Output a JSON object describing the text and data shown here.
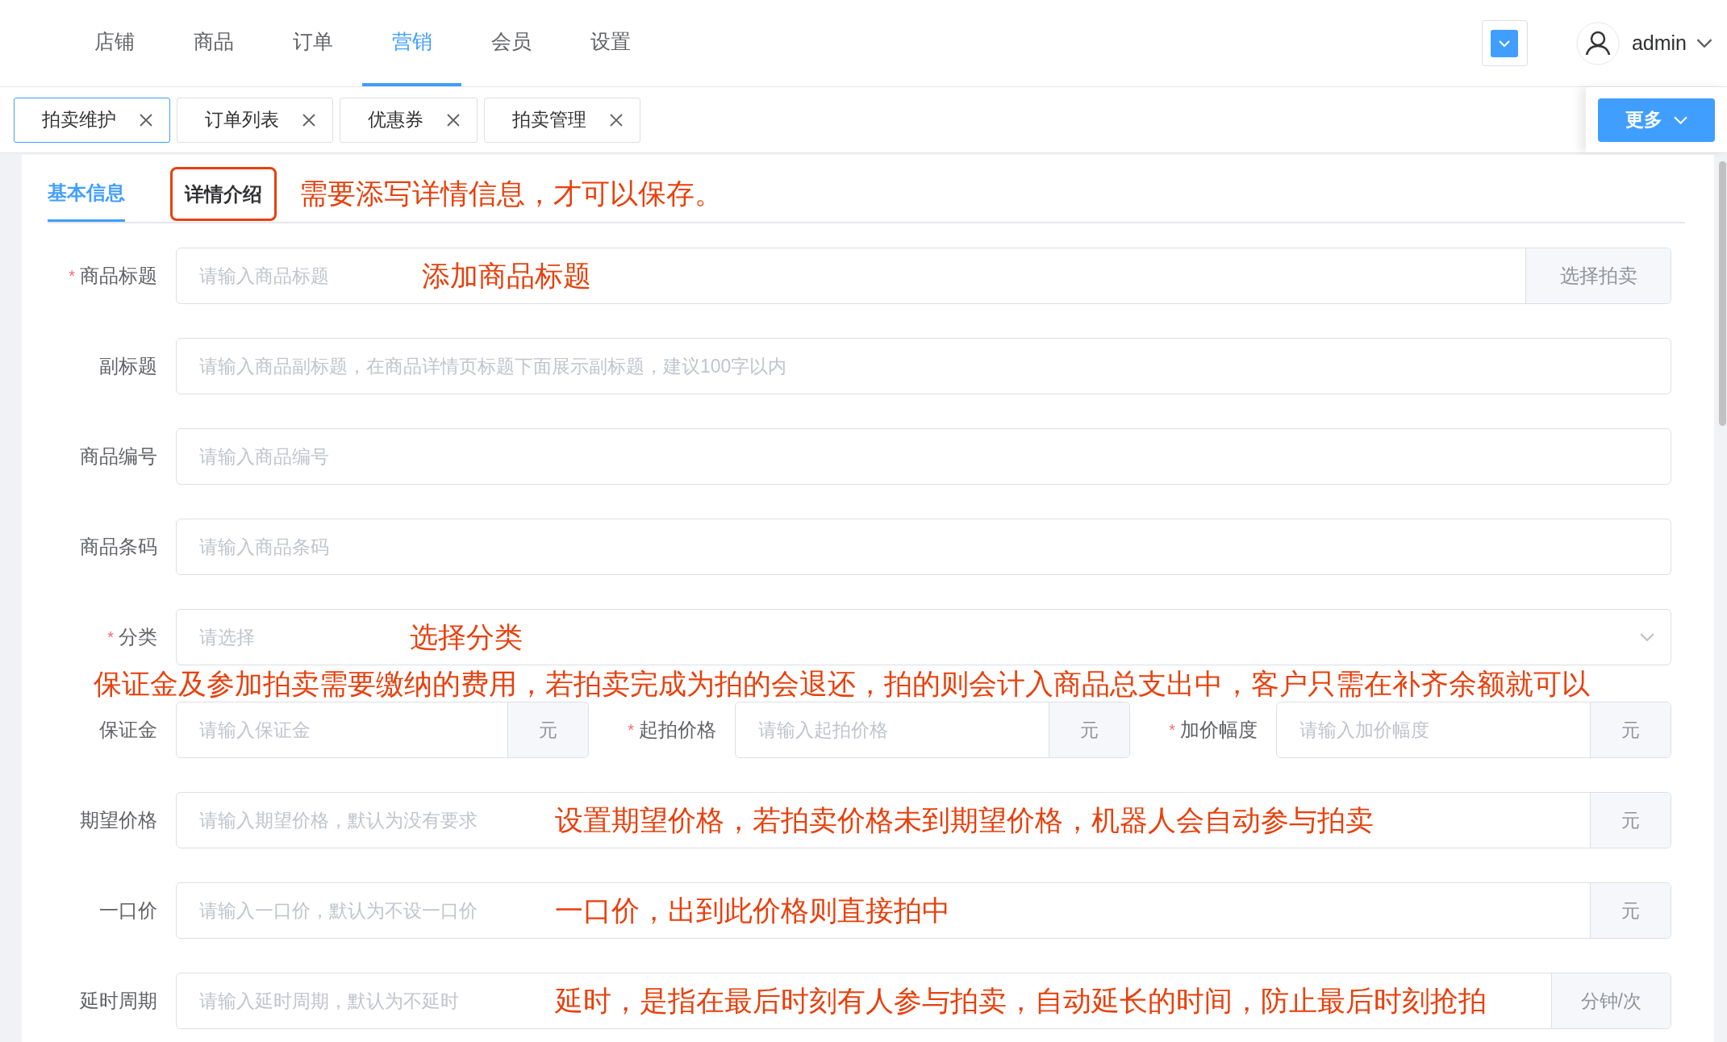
{
  "nav": {
    "items": [
      {
        "label": "店铺",
        "selected": false
      },
      {
        "label": "商品",
        "selected": false
      },
      {
        "label": "订单",
        "selected": false
      },
      {
        "label": "营销",
        "selected": true
      },
      {
        "label": "会员",
        "selected": false
      },
      {
        "label": "设置",
        "selected": false
      }
    ],
    "user": "admin"
  },
  "tags": [
    {
      "label": "拍卖维护",
      "selected": true
    },
    {
      "label": "订单列表",
      "selected": false
    },
    {
      "label": "优惠券",
      "selected": false
    },
    {
      "label": "拍卖管理",
      "selected": false
    }
  ],
  "more_button": "更多",
  "form_tabs": [
    {
      "label": "基本信息",
      "selected": true,
      "highlighted": false
    },
    {
      "label": "详情介绍",
      "selected": false,
      "highlighted": true
    }
  ],
  "tab_note": "需要添写详情信息，才可以保存。",
  "rows": [
    {
      "kind": "field",
      "label": "商品标题",
      "required_mark": "*",
      "placeholder": "请输入商品标题",
      "suffix": {
        "kind": "button",
        "text": "选择拍卖"
      },
      "annotation": "添加商品标题"
    },
    {
      "kind": "field",
      "label": "副标题",
      "placeholder": "请输入商品副标题，在商品详情页标题下面展示副标题，建议100字以内"
    },
    {
      "kind": "field",
      "label": "商品编号",
      "placeholder": "请输入商品编号"
    },
    {
      "kind": "field",
      "label": "商品条码",
      "placeholder": "请输入商品条码"
    },
    {
      "kind": "select",
      "label": "分类",
      "required_mark": "*",
      "placeholder": "请选择",
      "annotation": "选择分类"
    },
    {
      "kind": "note",
      "text": "保证金及参加拍卖需要缴纳的费用，若拍卖完成为拍的会退还，拍的则会计入商品总支出中，客户只需在补齐余额就可以"
    },
    {
      "kind": "group",
      "items": [
        {
          "label": "保证金",
          "placeholder": "请输入保证金",
          "suffix": {
            "kind": "addon",
            "text": "元"
          }
        },
        {
          "label": "起拍价格",
          "required_mark": "*",
          "placeholder": "请输入起拍价格",
          "suffix": {
            "kind": "addon",
            "text": "元"
          }
        },
        {
          "label": "加价幅度",
          "required_mark": "*",
          "placeholder": "请输入加价幅度",
          "suffix": {
            "kind": "addon",
            "text": "元"
          }
        }
      ]
    },
    {
      "kind": "field",
      "label": "期望价格",
      "placeholder": "请输入期望价格，默认为没有要求",
      "suffix": {
        "kind": "addon",
        "text": "元"
      },
      "annotation": "设置期望价格，若拍卖价格未到期望价格，机器人会自动参与拍卖"
    },
    {
      "kind": "field",
      "label": "一口价",
      "placeholder": "请输入一口价，默认为不设一口价",
      "suffix": {
        "kind": "addon",
        "text": "元"
      },
      "annotation": "一口价，出到此价格则直接拍中"
    },
    {
      "kind": "field",
      "label": "延时周期",
      "placeholder": "请输入延时周期，默认为不延时",
      "suffix": {
        "kind": "addon",
        "text": "分钟/次"
      },
      "annotation": "延时，是指在最后时刻有人参与拍卖，自动延长的时间，防止最后时刻抢拍"
    }
  ]
}
